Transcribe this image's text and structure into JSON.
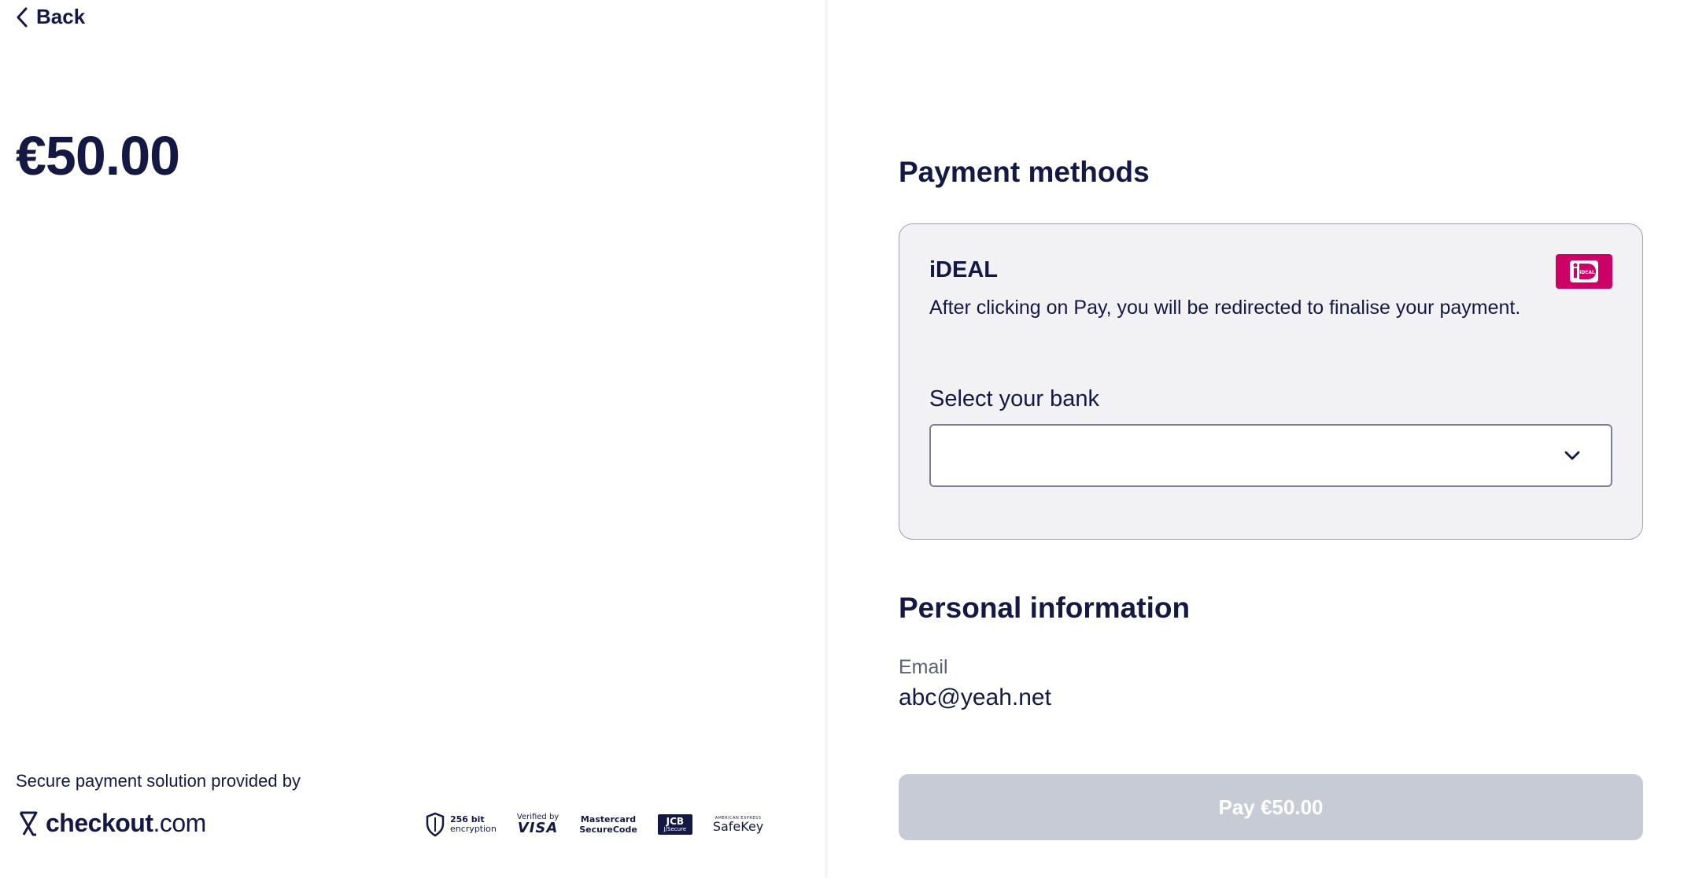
{
  "nav": {
    "back_label": "Back",
    "back_icon": "chevron-left-icon"
  },
  "summary": {
    "amount": "€50.00"
  },
  "footer": {
    "secure_text": "Secure payment solution provided by",
    "provider_bold": "checkout",
    "provider_suffix": ".com",
    "badges": {
      "encryption_line1": "256 bit",
      "encryption_line2": "encryption",
      "visa_line1": "Verified by",
      "visa_line2": "VISA",
      "mastercard_line1": "Mastercard",
      "mastercard_line2": "SecureCode",
      "jcb_line1": "JCB",
      "jcb_line2": "J/Secure",
      "amex_line1": "AMERICAN EXPRESS",
      "amex_line2": "SafeKey"
    }
  },
  "payment": {
    "title": "Payment methods",
    "method": {
      "name": "iDEAL",
      "description": "After clicking on Pay, you will be redirected to finalise your payment.",
      "bank_label": "Select your bank",
      "bank_value": "",
      "logo_text": "iDEAL"
    }
  },
  "personal": {
    "title": "Personal information",
    "email_label": "Email",
    "email_value": "abc@yeah.net"
  },
  "pay_button": {
    "label": "Pay €50.00",
    "state": "disabled"
  },
  "colors": {
    "text": "#141944",
    "ideal_brand": "#cc0066",
    "button_disabled": "#c6cbd5",
    "card_bg": "#f2f2f4",
    "card_border": "#9fa0b3"
  }
}
